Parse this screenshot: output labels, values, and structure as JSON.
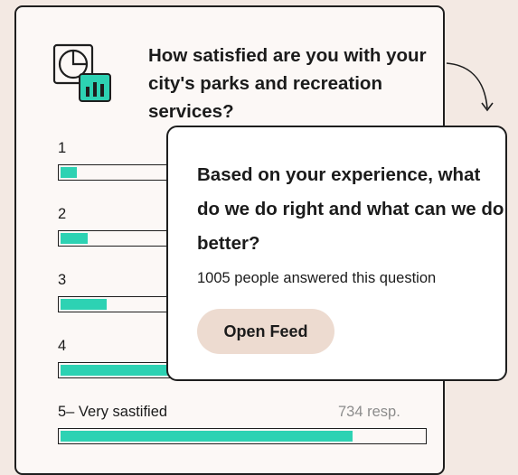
{
  "survey": {
    "question": "How satisfied are you with your city's parks and recreation services?",
    "options": [
      {
        "label": "1",
        "responses": "",
        "fill_percent": 5
      },
      {
        "label": "2",
        "responses": "",
        "fill_percent": 8
      },
      {
        "label": "3",
        "responses": "",
        "fill_percent": 13
      },
      {
        "label": "4",
        "responses": "",
        "fill_percent": 40
      },
      {
        "label": "5– Very sastified",
        "responses": "734 resp.",
        "fill_percent": 80
      }
    ]
  },
  "feed": {
    "question": "Based on your experience, what do we do right and what can we do better?",
    "answered_text": "1005 people answered this question",
    "button_label": "Open Feed"
  },
  "colors": {
    "background": "#f3e9e3",
    "bar_fill": "#2dd2b3",
    "button": "#eddbd0",
    "icon_badge": "#2dd2b3"
  },
  "icons": {
    "survey": "pie-chart-bar-chart-icon",
    "arrow": "curved-arrow-down-icon"
  }
}
